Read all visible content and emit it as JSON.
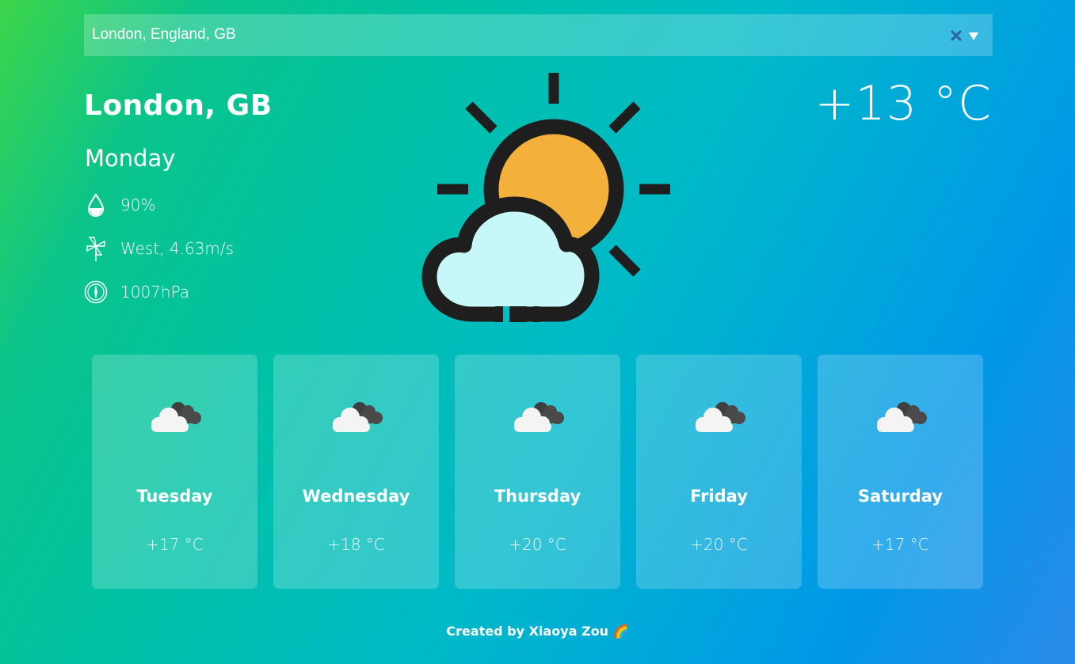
{
  "search": {
    "value": "London, England, GB",
    "clear_icon": "close-icon",
    "dropdown_icon": "chevron-down-icon"
  },
  "current": {
    "city": "London, GB",
    "day": "Monday",
    "temperature": "+13 °C",
    "icon": "partly-cloudy-sun-icon",
    "details": [
      {
        "icon": "humidity-drop-icon",
        "value": "90%"
      },
      {
        "icon": "wind-pinwheel-icon",
        "value": "West, 4.63m/s"
      },
      {
        "icon": "pressure-compass-icon",
        "value": "1007hPa"
      }
    ]
  },
  "forecast": [
    {
      "day": "Tuesday",
      "temp": "+17 °C",
      "icon": "overcast-clouds-icon"
    },
    {
      "day": "Wednesday",
      "temp": "+18 °C",
      "icon": "overcast-clouds-icon"
    },
    {
      "day": "Thursday",
      "temp": "+20 °C",
      "icon": "overcast-clouds-icon"
    },
    {
      "day": "Friday",
      "temp": "+20 °C",
      "icon": "overcast-clouds-icon"
    },
    {
      "day": "Saturday",
      "temp": "+17 °C",
      "icon": "overcast-clouds-icon"
    }
  ],
  "footer": {
    "text": "Created by Xiaoya Zou 🌈"
  },
  "colors": {
    "sun": "#f3b03a",
    "cloud": "#c8f7f9",
    "outline": "#1e1e1e",
    "small_cloud_front": "#f4f4f4",
    "small_cloud_back": "#4a4a4a",
    "clear_icon": "#2f5f9e"
  }
}
